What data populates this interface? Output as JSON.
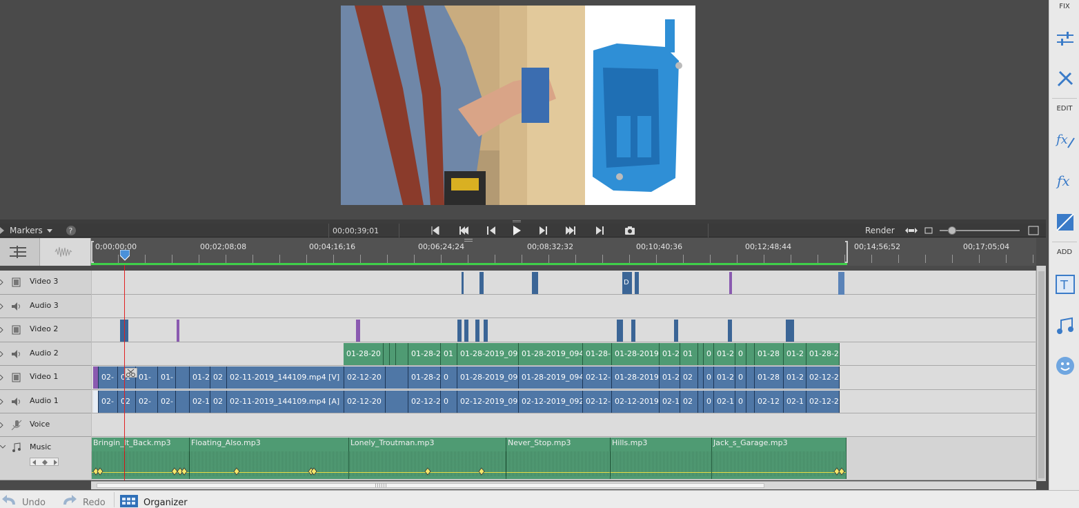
{
  "markers_label": "Markers",
  "timecode_current": "00;00;39;01",
  "render_label": "Render",
  "ruler_times": [
    "0;00;00;00",
    "00;02;08;08",
    "00;04;16;16",
    "00;06;24;24",
    "00;08;32;32",
    "00;10;40;36",
    "00;12;48;44",
    "00;14;56;52",
    "00;17;05;04"
  ],
  "right_panel": {
    "fix": "FIX",
    "edit": "EDIT",
    "add": "ADD"
  },
  "tracks": {
    "video3": "Video 3",
    "audio3": "Audio 3",
    "video2": "Video 2",
    "audio2": "Audio 2",
    "video1": "Video 1",
    "audio1": "Audio 1",
    "voice": "Voice",
    "music": "Music"
  },
  "audio2_clips": [
    "01-28-20",
    "01-28-2",
    "01",
    "01-28-2019_09",
    "01-28-2019_094",
    "01-28-",
    "01-28-2019",
    "01-2",
    "01",
    "0",
    "01-2",
    "0",
    "01-28",
    "01-2",
    "01-28-2"
  ],
  "video1_clips": [
    "02-",
    "01",
    "01-",
    "01-",
    "01-2",
    "02",
    "02-11-2019_144109.mp4 [V]",
    "02-12-20",
    "01-28-2",
    "0",
    "01-28-2019_09",
    "01-28-2019_094",
    "02-12-",
    "01-28-2019",
    "01-2",
    "02",
    "0",
    "01-2",
    "0",
    "01-28",
    "01-2",
    "02-12-2"
  ],
  "audio1_clips": [
    "02-",
    "02",
    "02-",
    "02-",
    "02-1",
    "02",
    "02-11-2019_144109.mp4 [A]",
    "02-12-20",
    "02-12-2",
    "0",
    "02-12-2019_09",
    "02-12-2019_092",
    "02-12-",
    "02-12-2019",
    "02-1",
    "02",
    "0",
    "02-1",
    "0",
    "02-12",
    "02-1",
    "02-12-2"
  ],
  "music_clips": [
    "Bringin_It_Back.mp3",
    "Floating_Also.mp3",
    "Lonely_Troutman.mp3",
    "Never_Stop.mp3",
    "Hills.mp3",
    "Jack_s_Garage.mp3"
  ],
  "video3_marker_text": "D",
  "bottom": {
    "undo": "Undo",
    "redo": "Redo",
    "organizer": "Organizer"
  },
  "colors": {
    "clip_blue": "#4f77a6",
    "clip_green": "#4f9b73",
    "marker_purple": "#8a5ab0",
    "playhead_red": "#e02020",
    "ruler_green": "#3fd04a"
  }
}
